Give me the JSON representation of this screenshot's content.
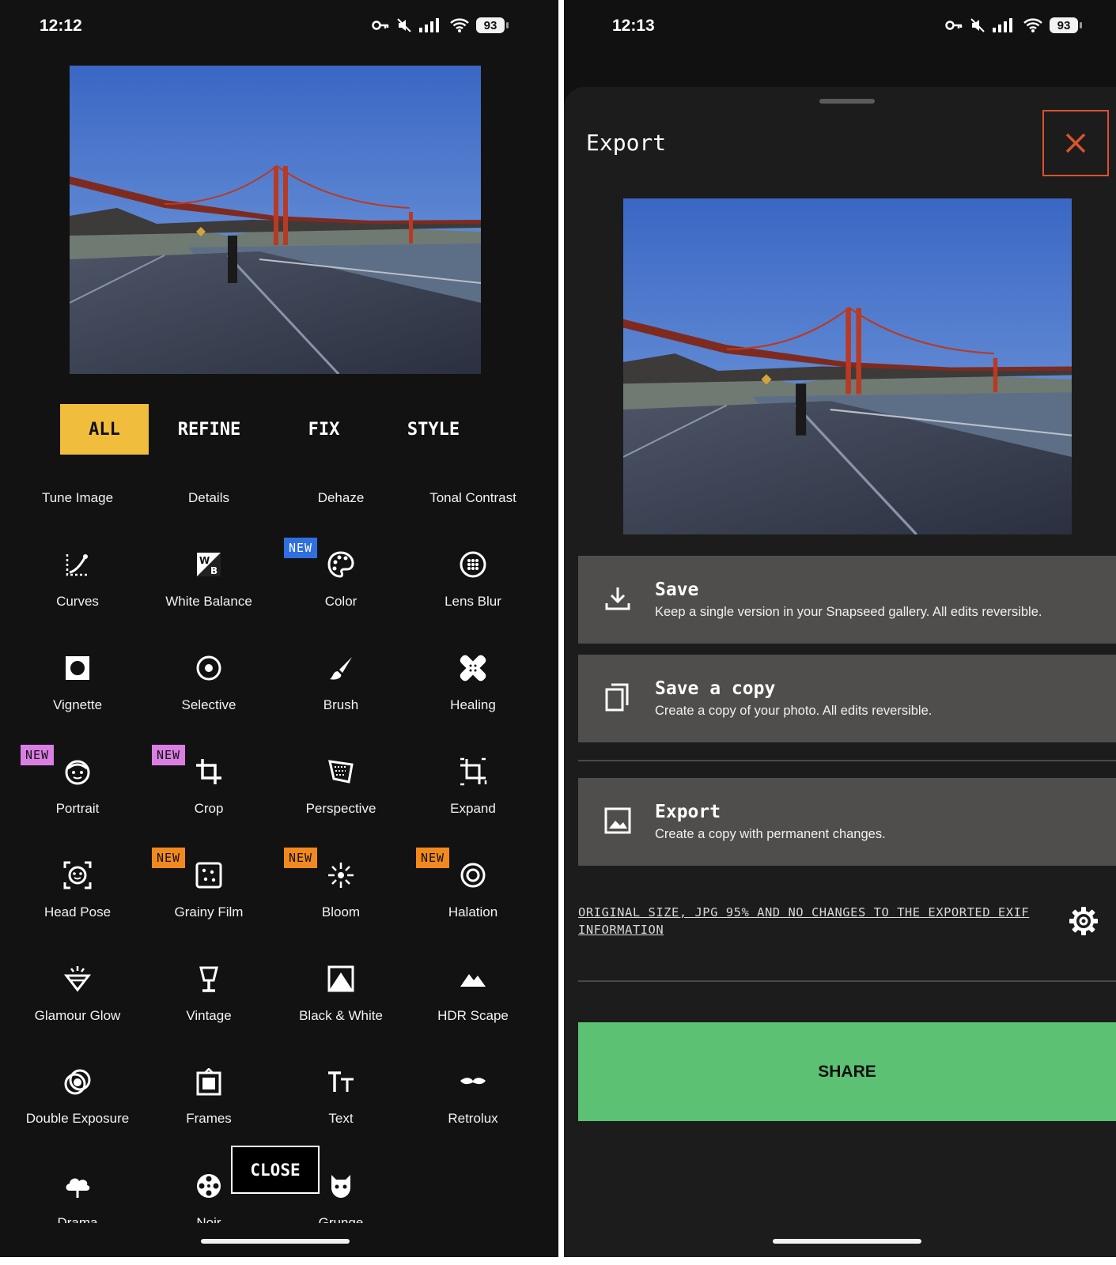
{
  "colors": {
    "accent_yellow": "#f1bd3c",
    "badge_blue": "#2f6fe0",
    "badge_pink": "#d97ee3",
    "badge_orange": "#f2891e",
    "close_x": "#d9522f",
    "share_green": "#5cc172"
  },
  "left_phone": {
    "status": {
      "time": "12:12",
      "battery": "93"
    },
    "tabs": [
      {
        "label": "ALL",
        "active": true
      },
      {
        "label": "REFINE",
        "active": false
      },
      {
        "label": "FIX",
        "active": false
      },
      {
        "label": "STYLE",
        "active": false
      }
    ],
    "text_tools": [
      "Tune Image",
      "Details",
      "Dehaze",
      "Tonal Contrast"
    ],
    "tools": [
      {
        "label": "Curves",
        "icon": "curves-icon"
      },
      {
        "label": "White Balance",
        "icon": "white-balance-icon"
      },
      {
        "label": "Color",
        "icon": "palette-icon",
        "badge": "NEW",
        "badge_color": "blue"
      },
      {
        "label": "Lens Blur",
        "icon": "lens-blur-icon"
      },
      {
        "label": "Vignette",
        "icon": "vignette-icon"
      },
      {
        "label": "Selective",
        "icon": "selective-icon"
      },
      {
        "label": "Brush",
        "icon": "brush-icon"
      },
      {
        "label": "Healing",
        "icon": "healing-icon"
      },
      {
        "label": "Portrait",
        "icon": "portrait-icon",
        "badge": "NEW",
        "badge_color": "pink"
      },
      {
        "label": "Crop",
        "icon": "crop-icon",
        "badge": "NEW",
        "badge_color": "pink"
      },
      {
        "label": "Perspective",
        "icon": "perspective-icon"
      },
      {
        "label": "Expand",
        "icon": "expand-icon"
      },
      {
        "label": "Head Pose",
        "icon": "head-pose-icon"
      },
      {
        "label": "Grainy Film",
        "icon": "grainy-film-icon",
        "badge": "NEW",
        "badge_color": "orange"
      },
      {
        "label": "Bloom",
        "icon": "bloom-icon",
        "badge": "NEW",
        "badge_color": "orange"
      },
      {
        "label": "Halation",
        "icon": "halation-icon",
        "badge": "NEW",
        "badge_color": "orange"
      },
      {
        "label": "Glamour Glow",
        "icon": "glamour-glow-icon"
      },
      {
        "label": "Vintage",
        "icon": "vintage-lamp-icon"
      },
      {
        "label": "Black & White",
        "icon": "black-white-icon"
      },
      {
        "label": "HDR Scape",
        "icon": "mountain-icon"
      },
      {
        "label": "Double Exposure",
        "icon": "double-exposure-icon"
      },
      {
        "label": "Frames",
        "icon": "frames-icon"
      },
      {
        "label": "Text",
        "icon": "text-icon"
      },
      {
        "label": "Retrolux",
        "icon": "mustache-icon"
      },
      {
        "label": "Drama",
        "icon": "cloud-icon"
      },
      {
        "label": "Noir",
        "icon": "film-reel-icon"
      },
      {
        "label": "Grunge",
        "icon": "grunge-icon"
      }
    ],
    "close_label": "CLOSE"
  },
  "right_phone": {
    "status": {
      "time": "12:13",
      "battery": "93"
    },
    "sheet_title": "Export",
    "options": [
      {
        "title": "Save",
        "description": "Keep a single version in your Snapseed gallery. All edits reversible.",
        "icon": "download-icon"
      },
      {
        "title": "Save a copy",
        "description": "Create a copy of your photo. All edits reversible.",
        "icon": "copy-icon"
      },
      {
        "title": "Export",
        "description": "Create a copy with permanent changes.",
        "icon": "image-icon"
      }
    ],
    "export_info": "ORIGINAL SIZE, JPG 95% AND NO CHANGES TO THE EXPORTED EXIF INFORMATION",
    "share_label": "SHARE"
  }
}
